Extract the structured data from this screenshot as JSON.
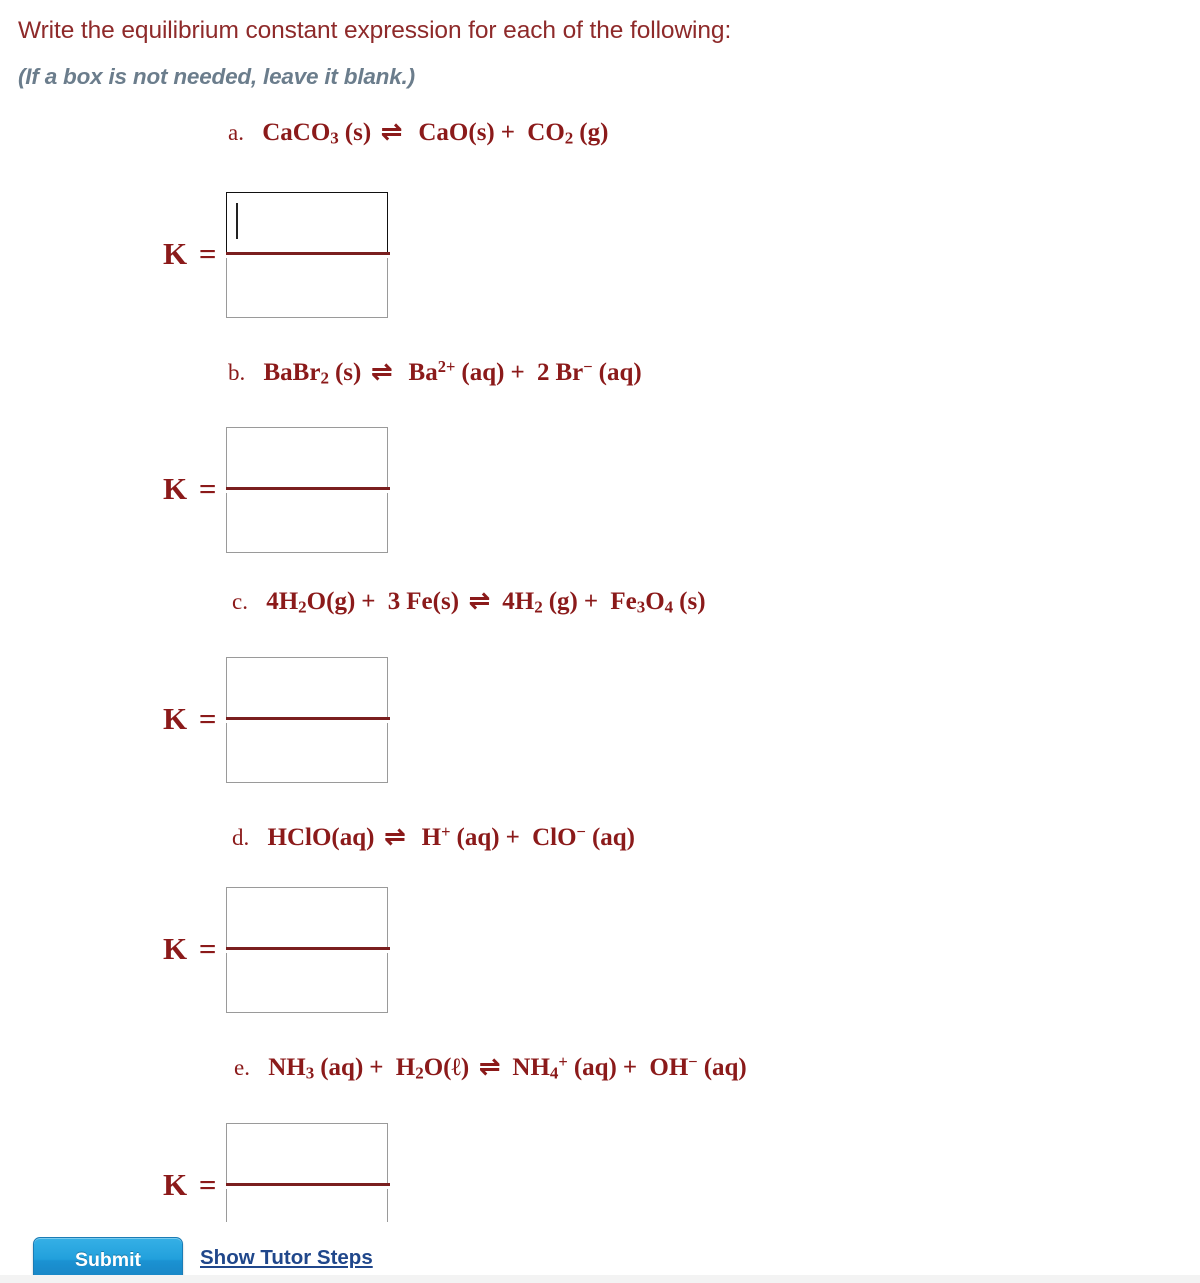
{
  "prompt": {
    "instruction": "Write the equilibrium constant expression for each of the following:",
    "note": "(If a box is not needed, leave it blank.)",
    "text_color": "#8e2a2a",
    "note_color": "#6b7d8c"
  },
  "problems": [
    {
      "label": "a.",
      "equation_plain": "CaCO3(s) ⇌ CaO(s) + CO2(g)",
      "k_label": "K =",
      "numerator_value": "",
      "denominator_value": "",
      "focused_field": "numerator"
    },
    {
      "label": "b.",
      "equation_plain": "BaBr2(s) ⇌ Ba2+(aq) + 2 Br-(aq)",
      "k_label": "K =",
      "numerator_value": "",
      "denominator_value": "",
      "focused_field": ""
    },
    {
      "label": "c.",
      "equation_plain": "4H2O(g) + 3 Fe(s) ⇌ 4H2(g) + Fe3O4(s)",
      "k_label": "K =",
      "numerator_value": "",
      "denominator_value": "",
      "focused_field": ""
    },
    {
      "label": "d.",
      "equation_plain": "HClO(aq) ⇌ H+(aq) + ClO-(aq)",
      "k_label": "K =",
      "numerator_value": "",
      "denominator_value": "",
      "focused_field": ""
    },
    {
      "label": "e.",
      "equation_plain": "NH3(aq) + H2O(ℓ) ⇌ NH4+(aq) + OH-(aq)",
      "k_label": "K =",
      "numerator_value": "",
      "denominator_value": "",
      "focused_field": ""
    }
  ],
  "footer": {
    "submit_label": "Submit",
    "tutor_link_label": "Show Tutor Steps",
    "submit_color": "#22a0dc",
    "link_color": "#20478b"
  }
}
